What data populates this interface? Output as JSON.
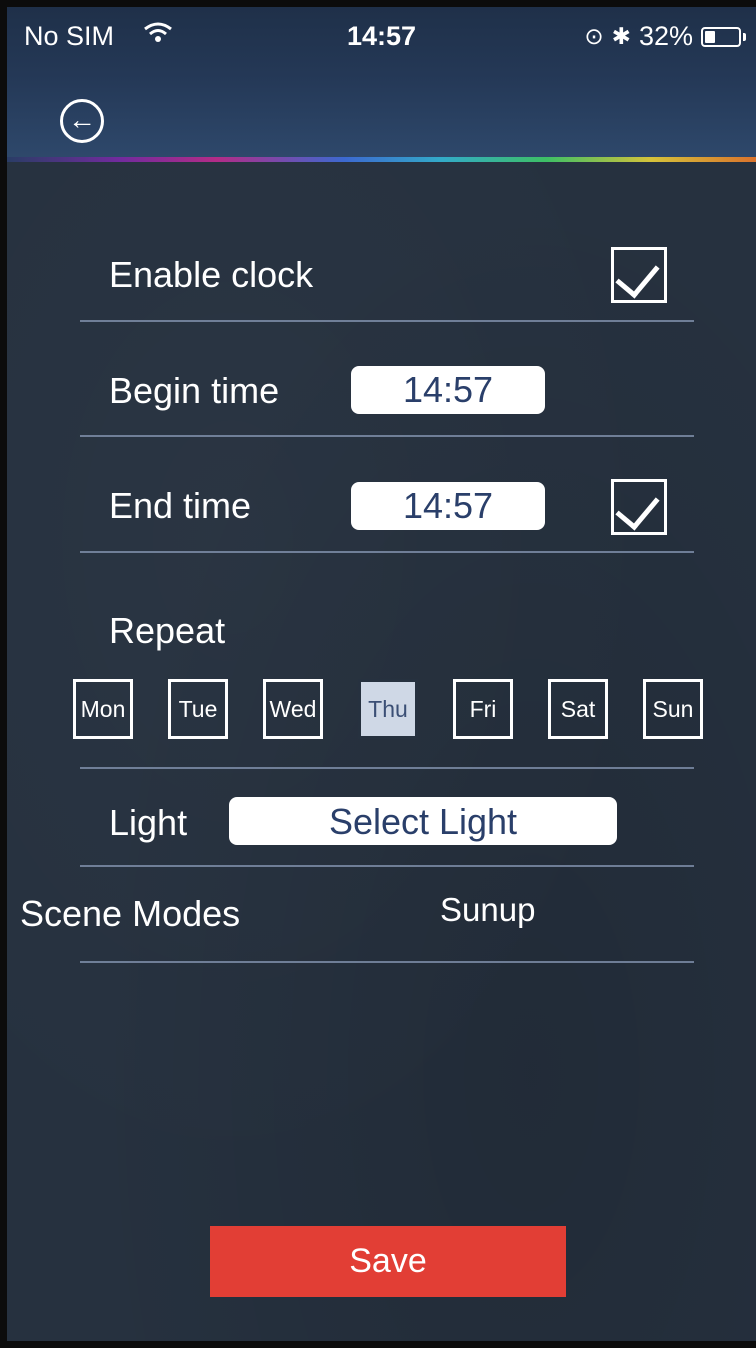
{
  "status_bar": {
    "carrier": "No SIM",
    "time": "14:57",
    "battery_percent": "32%",
    "battery_level": 0.32
  },
  "header": {
    "back_icon": "arrow-left-circle-icon"
  },
  "clock": {
    "enable_label": "Enable clock",
    "enable_checked": true
  },
  "begin": {
    "label": "Begin time",
    "value": "14:57"
  },
  "end": {
    "label": "End time",
    "value": "14:57",
    "checked": true
  },
  "repeat": {
    "label": "Repeat",
    "days": [
      {
        "label": "Mon",
        "selected": false
      },
      {
        "label": "Tue",
        "selected": false
      },
      {
        "label": "Wed",
        "selected": false
      },
      {
        "label": "Thu",
        "selected": true
      },
      {
        "label": "Fri",
        "selected": false
      },
      {
        "label": "Sat",
        "selected": false
      },
      {
        "label": "Sun",
        "selected": false
      }
    ]
  },
  "light": {
    "label": "Light",
    "button": "Select Light"
  },
  "scene": {
    "label": "Scene Modes",
    "value": "Sunup"
  },
  "save_label": "Save",
  "colors": {
    "background": "#26313f",
    "save_button": "#e23e35",
    "selected_day": "#cfd8e6",
    "field_text": "#2a3f6a"
  }
}
